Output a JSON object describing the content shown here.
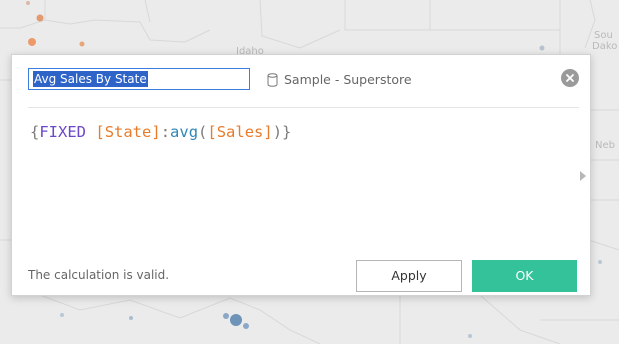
{
  "map": {
    "labels": [
      "Idaho",
      "Sou",
      "Dako",
      "Neb"
    ]
  },
  "dialog": {
    "calc_name": "Avg Sales By State",
    "datasource": "Sample - Superstore",
    "formula": {
      "open_brace": "{",
      "keyword": "FIXED",
      "field1": "[State]",
      "colon": ":",
      "function": "avg",
      "paren_open": "(",
      "field2": "[Sales]",
      "paren_close": ")",
      "close_brace": "}"
    },
    "status": "The calculation is valid.",
    "apply_label": "Apply",
    "ok_label": "OK"
  },
  "colors": {
    "accent_ok": "#33c29a",
    "keyword": "#6b48c8",
    "field": "#e87c2c",
    "function": "#2f86b8",
    "selection": "#2e63c8"
  }
}
